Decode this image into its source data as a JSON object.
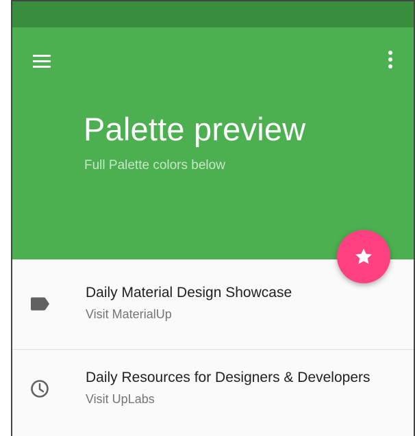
{
  "app": {
    "accent_color": "#4caf50",
    "accent_dark_color": "#388e3c",
    "fab_color": "#ff4081"
  },
  "toolbar": {
    "menu_icon": "menu-icon",
    "more_icon": "more-vert-icon"
  },
  "header": {
    "title": "Palette preview",
    "subtitle": "Full Palette colors below"
  },
  "fab": {
    "icon": "star-icon"
  },
  "list": {
    "items": [
      {
        "icon": "label-icon",
        "primary": "Daily Material Design Showcase",
        "secondary": "Visit MaterialUp"
      },
      {
        "icon": "clock-icon",
        "primary": "Daily Resources for Designers & Developers",
        "secondary": "Visit UpLabs"
      }
    ]
  }
}
